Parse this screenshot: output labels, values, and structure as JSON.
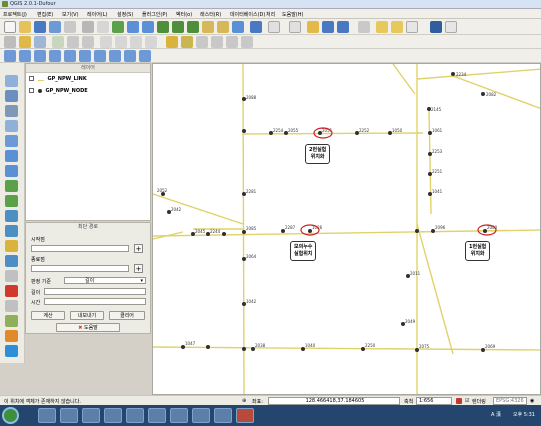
{
  "window": {
    "title": "QGIS 2.0.1-Dufour"
  },
  "menu": [
    "프로젝트(J)",
    "편집(E)",
    "보기(V)",
    "레이어(L)",
    "설정(S)",
    "플러그인(P)",
    "벡터(o)",
    "래스터(R)",
    "데이터베이스(D)",
    "처리",
    "도움말(H)"
  ],
  "layers_panel": {
    "title": "레이어",
    "layers": [
      {
        "name": "GP_NPW_LINK",
        "type": "line"
      },
      {
        "name": "GP_NPW_NODE",
        "type": "point"
      }
    ]
  },
  "route_panel": {
    "title": "최단 경로",
    "start_label": "시작점",
    "end_label": "종료점",
    "criterion_label": "판정 기준",
    "criterion_value": "길이",
    "length_label": "길이",
    "time_label": "시간",
    "calc_button": "계산",
    "export_button": "내보내기",
    "clear_button": "클리어",
    "help_button": "도움말"
  },
  "map": {
    "callouts": [
      {
        "id": "exp2",
        "text": [
          "2번실험",
          "위치화"
        ]
      },
      {
        "id": "leak",
        "text": [
          "모의누수",
          "실험위치"
        ]
      },
      {
        "id": "exp1",
        "text": [
          "1번실험",
          "위치화"
        ]
      }
    ],
    "node_labels": [
      "2234",
      "2082",
      "2088",
      "2145",
      "2254",
      "2055",
      "2051",
      "2252",
      "1050",
      "1061",
      "2253",
      "2251",
      "1041",
      "2281",
      "2052",
      "2042",
      "2045",
      "2244",
      "2085",
      "2287",
      "1026",
      "2096",
      "2080",
      "2064",
      "1042",
      "2011",
      "2049",
      "1047",
      "2038",
      "1040",
      "2250",
      "2075",
      "2069"
    ]
  },
  "status": {
    "message": "이 위치에 객체가 존재하지 않습니다.",
    "coord_label": "좌표:",
    "coord_value": "128.466418,37.184605",
    "scale_label": "축척",
    "scale_value": "1:656",
    "render_label": "렌더링",
    "crs": "EPSG:4326"
  },
  "taskbar": {
    "tray": "A 漢",
    "clock": "오후 5:31"
  },
  "colors": {
    "road": "#e0d26a",
    "node": "#303030",
    "callout_ring": "#cc2020"
  }
}
